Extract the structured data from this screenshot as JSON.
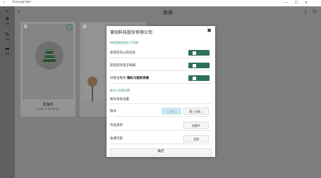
{
  "window": {
    "title": "Everywriter",
    "controls": [
      "—",
      "☐",
      "✕"
    ]
  },
  "sidebar": {
    "items": [
      {
        "label": "",
        "icon": "brand-icon"
      },
      {
        "label": "创作",
        "icon": "pen-icon"
      },
      {
        "label": "编辑",
        "icon": "edit-icon"
      },
      {
        "label": "发布",
        "icon": "share-icon"
      }
    ]
  },
  "header": {
    "title": "发表",
    "help": "?"
  },
  "cards": [
    {
      "title": "雷海布",
      "subtitle": "2020-11-29 00:00"
    }
  ],
  "dialog": {
    "title": "掌阅科技股份有限公司",
    "close": "✖",
    "section1": "授权您能完成以下权限",
    "permissions": [
      {
        "label": "获得您的公开信息"
      },
      {
        "label": "获得您的电子邮箱"
      },
      {
        "label_prefix": "同意出版商",
        "label_bold": "隐私与版权条款"
      }
    ],
    "section2": "账号与发表设置",
    "settings_header": "账号发表设置",
    "account": {
      "label": "账号",
      "btn_a": "已确定",
      "btn_b": "第三方账..."
    },
    "works": {
      "label": "作品发布",
      "btn": "连载中"
    },
    "free": {
      "label": "免费内容",
      "btn": "全部"
    },
    "ok": "确定"
  },
  "colors": {
    "accent": "#2f8f7f",
    "toggle": "#2d6f5b"
  }
}
